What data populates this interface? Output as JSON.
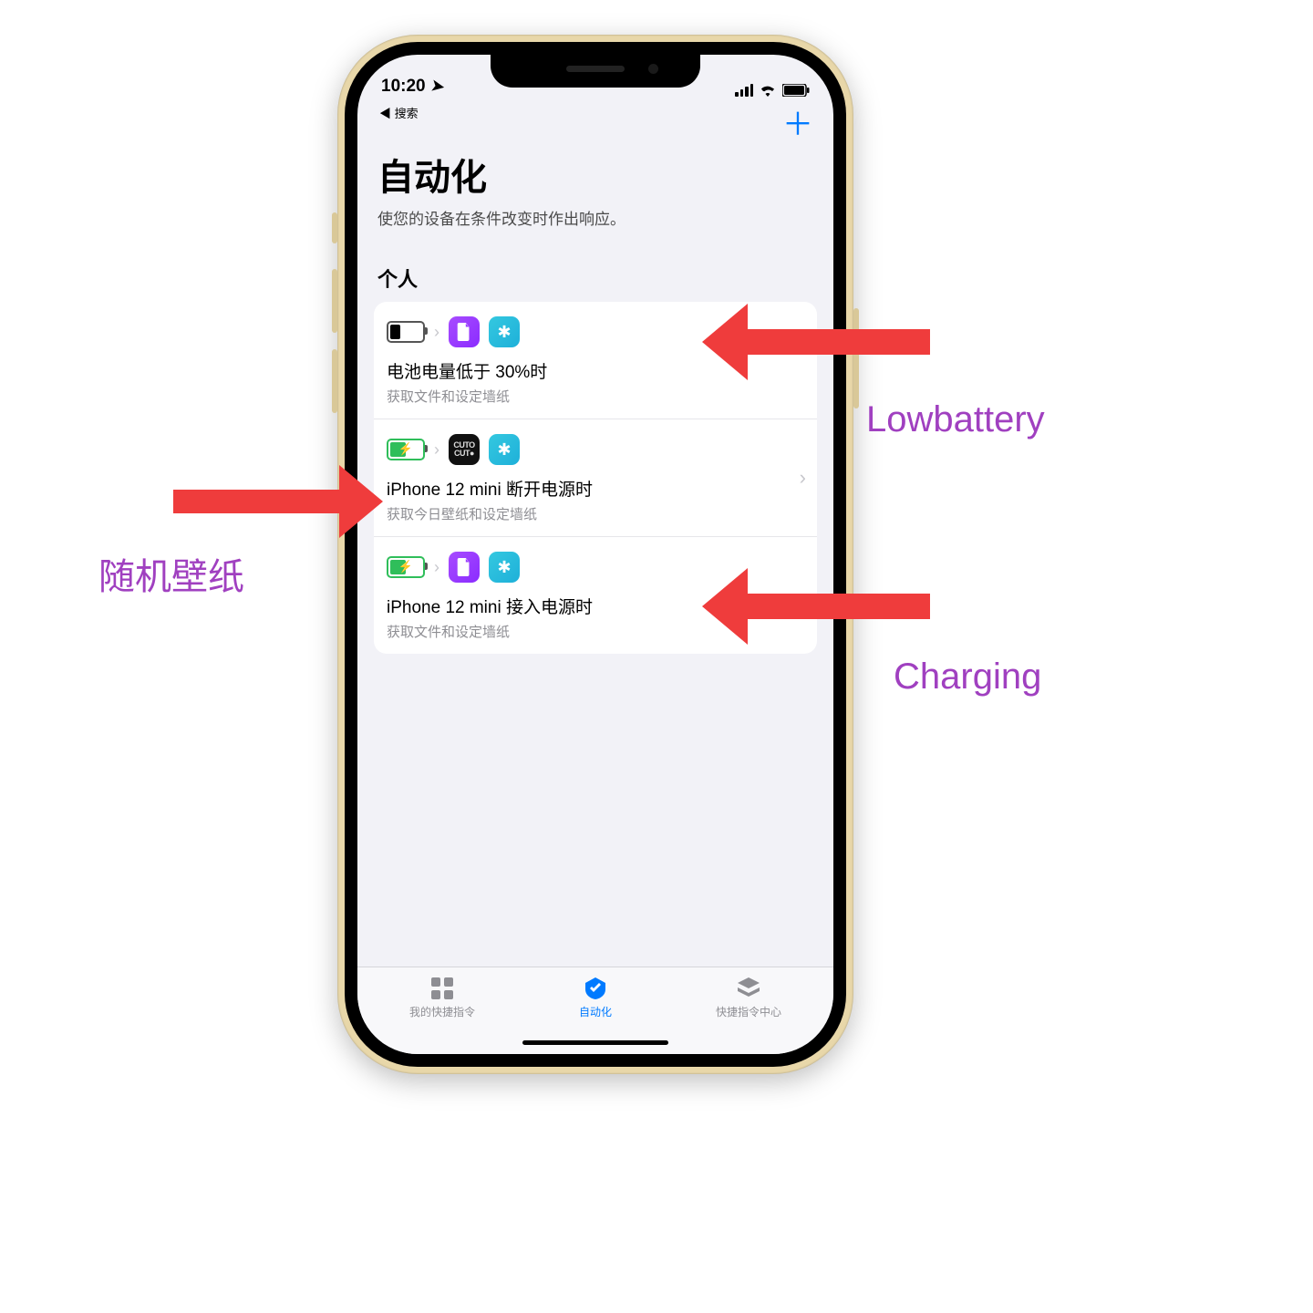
{
  "status": {
    "time": "10:20",
    "back_label": "◀ 搜索"
  },
  "nav": {
    "add_glyph": "＋"
  },
  "header": {
    "title": "自动化",
    "subtitle": "使您的设备在条件改变时作出响应。"
  },
  "section": {
    "personal": "个人"
  },
  "colors": {
    "accent": "#007aff",
    "annotation_text": "#a040c0",
    "arrow": "#ef3c3c"
  },
  "items": [
    {
      "title": "电池电量低于 30%时",
      "sub": "获取文件和设定墙纸",
      "trigger": "battery-low",
      "step_icons": [
        "file-purple",
        "gear-blue"
      ]
    },
    {
      "title": "iPhone 12 mini 断开电源时",
      "sub": "获取今日壁纸和设定墙纸",
      "trigger": "charging",
      "step_icons": [
        "cuto-black",
        "gear-blue"
      ],
      "disclose": true
    },
    {
      "title": "iPhone 12 mini 接入电源时",
      "sub": "获取文件和设定墙纸",
      "trigger": "charging",
      "step_icons": [
        "file-purple",
        "gear-blue"
      ]
    }
  ],
  "tabs": {
    "shortcuts": "我的快捷指令",
    "automation": "自动化",
    "gallery": "快捷指令中心"
  },
  "annotations": {
    "left": "随机壁纸",
    "right_top": "Lowbattery",
    "right_bottom": "Charging"
  }
}
